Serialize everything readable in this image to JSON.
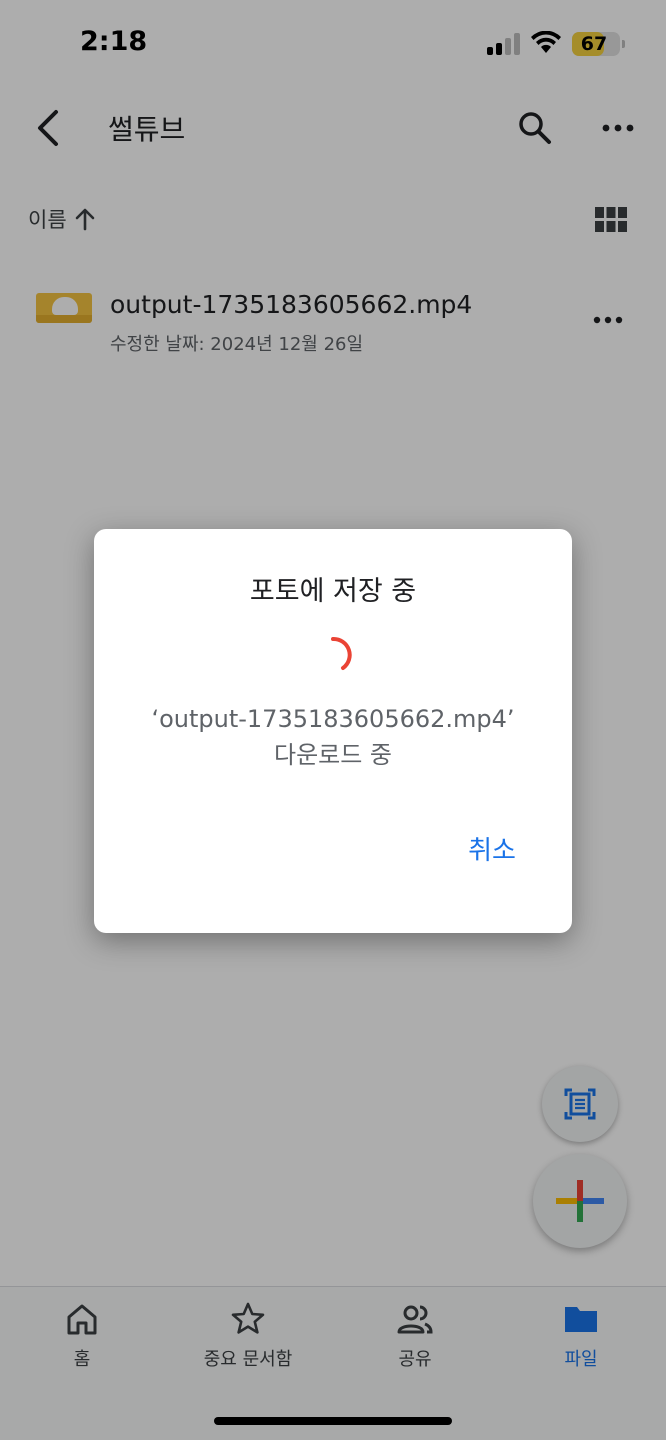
{
  "status_bar": {
    "time": "2:18",
    "battery": "67",
    "battery_level_percent": 67
  },
  "app_bar": {
    "title": "썰튜브",
    "back_icon": "chevron-left-icon",
    "search_icon": "search-icon",
    "more_icon": "more-horizontal-icon"
  },
  "sort": {
    "label": "이름",
    "direction_icon": "arrow-up-icon",
    "view_icon": "grid-view-icon"
  },
  "files": [
    {
      "name": "output-1735183605662.mp4",
      "meta": "수정한 날짜: 2024년 12월 26일"
    }
  ],
  "dialog": {
    "title": "포토에 저장 중",
    "message_line1": "‘output-1735183605662.mp4’",
    "message_line2": "다운로드 중",
    "cancel_label": "취소"
  },
  "fabs": {
    "scan_icon": "document-scan-icon",
    "add_icon": "plus-icon"
  },
  "bottom_nav": {
    "items": [
      {
        "label": "홈",
        "icon": "home-icon"
      },
      {
        "label": "중요 문서함",
        "icon": "star-icon"
      },
      {
        "label": "공유",
        "icon": "people-icon"
      },
      {
        "label": "파일",
        "icon": "folder-icon"
      }
    ],
    "active_index": 3
  },
  "colors": {
    "accent": "#1a73e8",
    "spinner": "#ea4335",
    "scrim": "rgba(0,0,0,0.32)"
  }
}
